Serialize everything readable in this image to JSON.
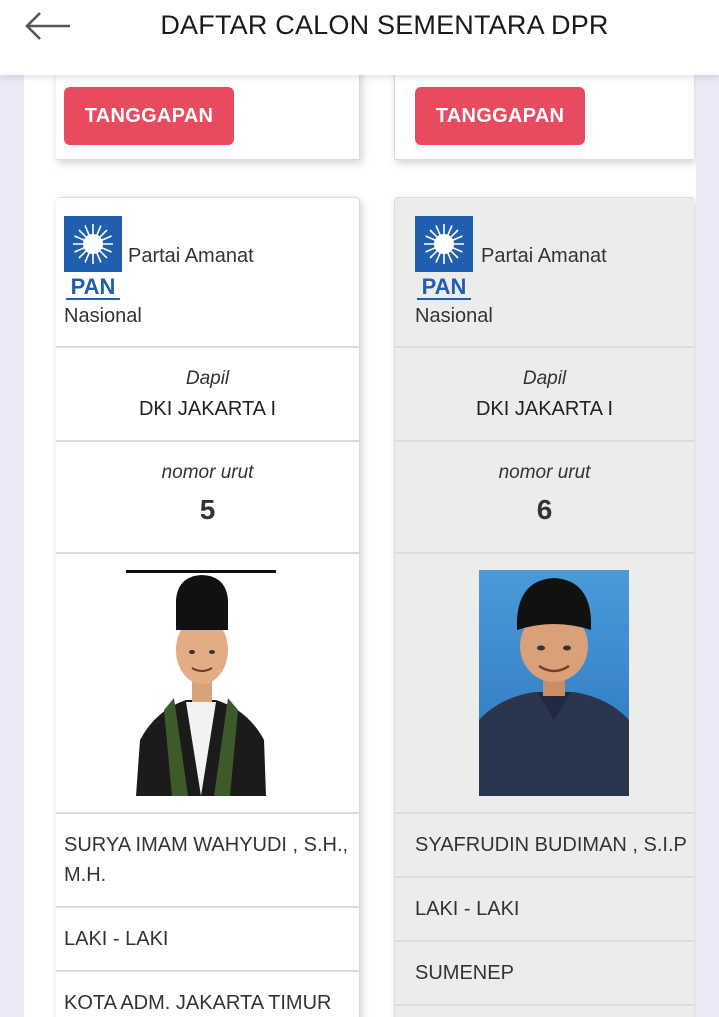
{
  "header": {
    "title": "DAFTAR CALON SEMENTARA DPR"
  },
  "buttons": {
    "response_label": "TANGGAPAN"
  },
  "colors": {
    "accent": "#e84a5f",
    "pan_blue": "#1f5fae"
  },
  "candidates": [
    {
      "party_line1": "Partai Amanat",
      "party_line2": "Nasional",
      "logo_text": "PAN",
      "dapil_label": "Dapil",
      "dapil": "DKI JAKARTA I",
      "nomor_label": "nomor urut",
      "nomor": "5",
      "name": "SURYA IMAM WAHYUDI , S.H., M.H.",
      "gender": "LAKI - LAKI",
      "city": "KOTA ADM. JAKARTA TIMUR"
    },
    {
      "party_line1": "Partai Amanat",
      "party_line2": "Nasional",
      "logo_text": "PAN",
      "dapil_label": "Dapil",
      "dapil": "DKI JAKARTA I",
      "nomor_label": "nomor urut",
      "nomor": "6",
      "name": "SYAFRUDIN BUDIMAN , S.I.P",
      "gender": "LAKI - LAKI",
      "city": "SUMENEP"
    }
  ]
}
